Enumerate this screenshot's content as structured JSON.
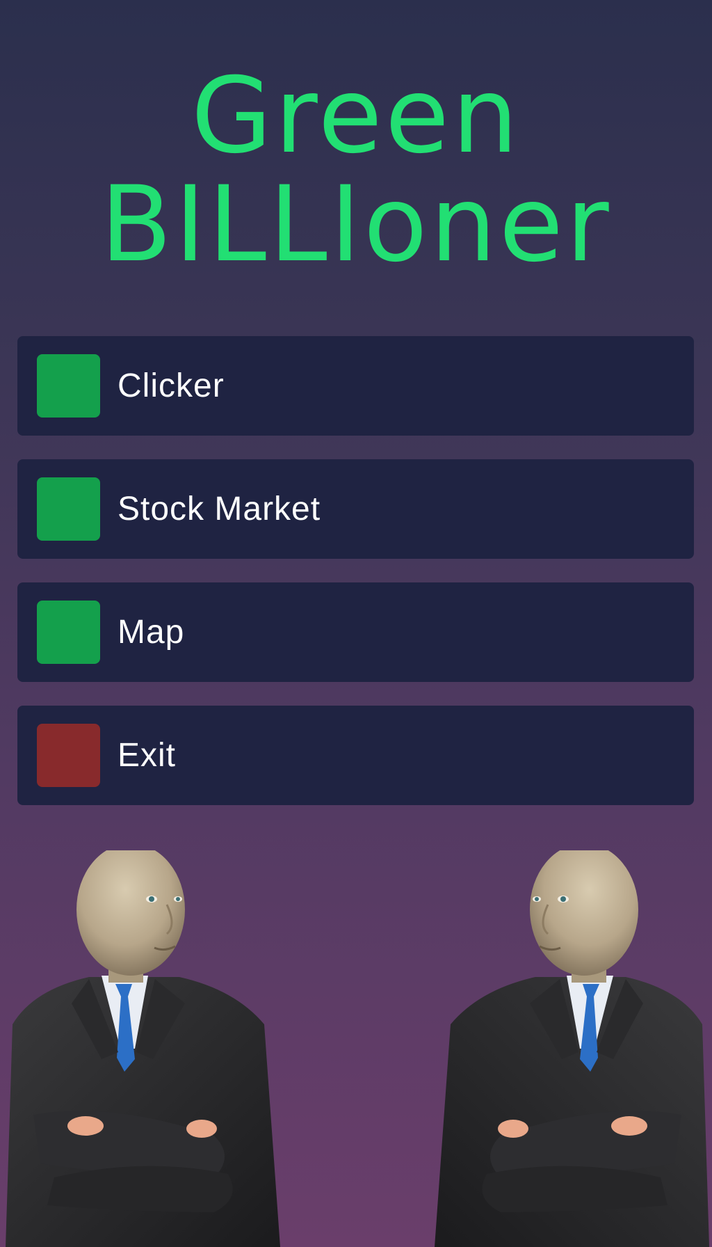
{
  "title": {
    "line1": "Green",
    "line2": "BILLIoner"
  },
  "colors": {
    "title": "#22df73",
    "menu_bg": "#1f2342",
    "swatch_green": "#14a04c",
    "swatch_red": "#882a2c"
  },
  "menu": {
    "items": [
      {
        "label": "Clicker",
        "swatch_color": "#14a04c"
      },
      {
        "label": "Stock Market",
        "swatch_color": "#14a04c"
      },
      {
        "label": "Map",
        "swatch_color": "#14a04c"
      },
      {
        "label": "Exit",
        "swatch_color": "#882a2c"
      }
    ]
  }
}
